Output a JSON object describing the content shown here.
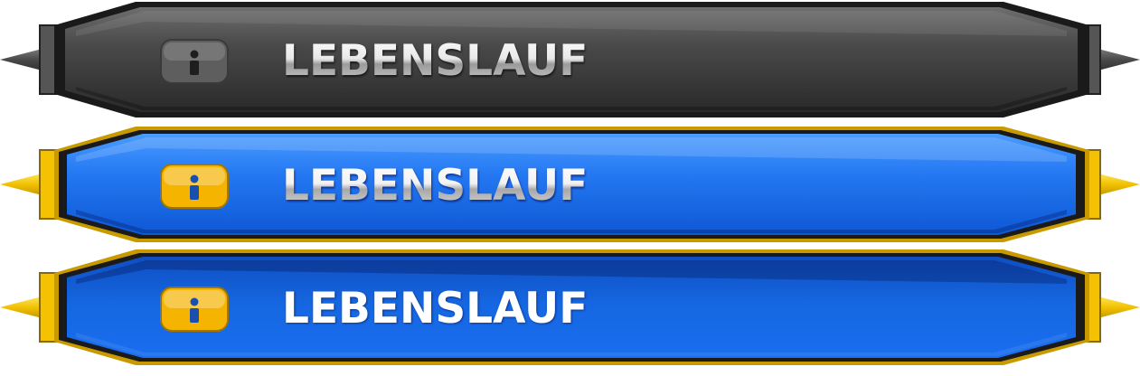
{
  "menu": {
    "items": [
      {
        "state": "normal",
        "label": "LEBENSLAUF",
        "icon": "person-info-icon",
        "colors": {
          "body": "#3a3a3a",
          "rim": "#1a1a1a",
          "accent": "#6a6a6a",
          "badge": "#5e5e5e"
        }
      },
      {
        "state": "hover",
        "label": "LEBENSLAUF",
        "icon": "person-info-icon",
        "colors": {
          "body": "#1f78f0",
          "rim": "#c89a00",
          "accent": "#ffd000",
          "badge": "#f4b400"
        }
      },
      {
        "state": "active",
        "label": "LEBENSLAUF",
        "icon": "person-info-icon",
        "colors": {
          "body": "#1560d8",
          "rim": "#c89a00",
          "accent": "#ffd000",
          "badge": "#f4b400"
        }
      }
    ]
  }
}
